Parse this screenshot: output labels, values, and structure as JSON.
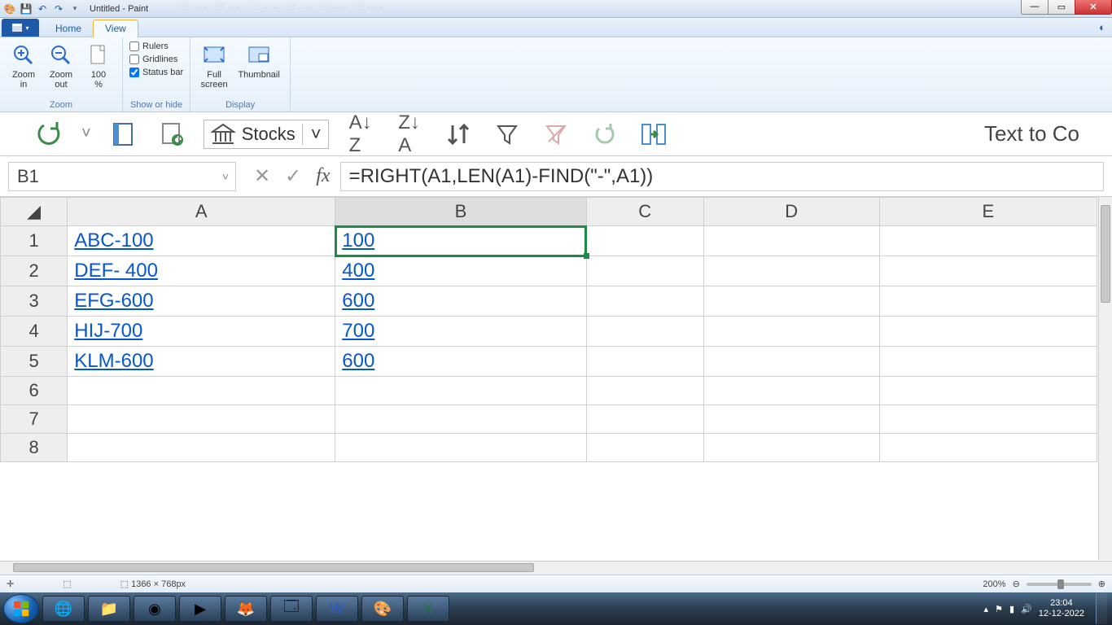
{
  "titlebar": {
    "title": "Untitled - Paint"
  },
  "window_controls": {
    "min": "—",
    "max": "▭",
    "close": "✕"
  },
  "tabs": {
    "home": "Home",
    "view": "View"
  },
  "ribbon": {
    "zoom": {
      "label": "Zoom",
      "zoom_in": "Zoom in",
      "zoom_out": "Zoom out",
      "pct": "100 %"
    },
    "show": {
      "label": "Show or hide",
      "rulers": "Rulers",
      "gridlines": "Gridlines",
      "statusbar": "Status bar"
    },
    "display": {
      "label": "Display",
      "full": "Full screen",
      "thumb": "Thumbnail"
    }
  },
  "excel": {
    "stocks_label": "Stocks",
    "text_to_co": "Text to Co",
    "namebox": "B1",
    "formula": "=RIGHT(A1,LEN(A1)-FIND(\"-\",A1))",
    "columns": [
      "A",
      "B",
      "C",
      "D",
      "E"
    ],
    "rows": [
      {
        "n": "1",
        "a": "ABC-100",
        "b": "100"
      },
      {
        "n": "2",
        "a": "DEF- 400",
        "b": " 400"
      },
      {
        "n": "3",
        "a": "EFG-600",
        "b": "600"
      },
      {
        "n": "4",
        "a": "HIJ-700",
        "b": "700"
      },
      {
        "n": "5",
        "a": "KLM-600",
        "b": "600"
      },
      {
        "n": "6",
        "a": "",
        "b": ""
      },
      {
        "n": "7",
        "a": "",
        "b": ""
      },
      {
        "n": "8",
        "a": "",
        "b": ""
      }
    ]
  },
  "statusbar": {
    "cursor_icon": "✛",
    "dims": "1366 × 768px",
    "zoom": "200%",
    "minus": "⊖",
    "plus": "⊕"
  },
  "taskbar": {
    "time": "23:04",
    "date": "12-12-2022"
  }
}
